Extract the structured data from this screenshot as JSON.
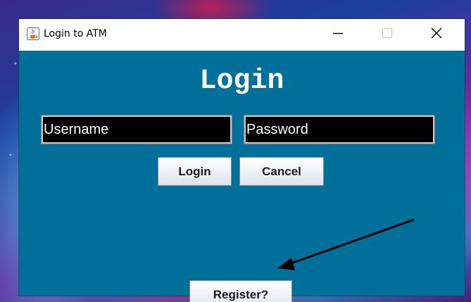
{
  "window": {
    "title": "Login to ATM",
    "app_icon": "java-cup-icon",
    "controls": {
      "minimize_icon": "minimize-icon",
      "maximize_icon": "maximize-icon",
      "close_icon": "close-icon"
    }
  },
  "form": {
    "heading": "Login",
    "username_value": "Username",
    "password_value": "Password",
    "login_label": "Login",
    "cancel_label": "Cancel",
    "register_label": "Register?"
  },
  "annotation": {
    "icon": "arrow-icon",
    "color": "#000000"
  },
  "colors": {
    "panel_background": "#006f9a",
    "field_background": "#000000",
    "field_text": "#ffffff",
    "heading_text": "#ffffff"
  }
}
